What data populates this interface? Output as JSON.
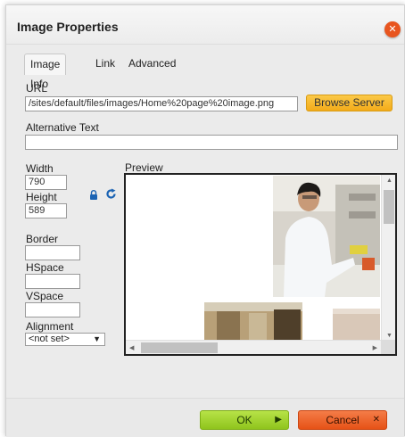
{
  "dialog": {
    "title": "Image Properties",
    "close_icon": "close-icon",
    "tabs": [
      {
        "label": "Image Info",
        "active": true
      },
      {
        "label": "Link",
        "active": false
      },
      {
        "label": "Advanced",
        "active": false
      }
    ]
  },
  "image_info": {
    "url_label": "URL",
    "url_value": "/sites/default/files/images/Home%20page%20image.png",
    "browse_label": "Browse Server",
    "alt_label": "Alternative Text",
    "alt_value": "",
    "width_label": "Width",
    "width_value": "790",
    "height_label": "Height",
    "height_value": "589",
    "lock_icon": "lock-icon",
    "reset_icon": "reset-size-icon",
    "border_label": "Border",
    "border_value": "",
    "hspace_label": "HSpace",
    "hspace_value": "",
    "vspace_label": "VSpace",
    "vspace_value": "",
    "alignment_label": "Alignment",
    "alignment_value": "<not set>",
    "preview_label": "Preview"
  },
  "footer": {
    "ok_label": "OK",
    "cancel_label": "Cancel"
  },
  "colors": {
    "browse": "#f3ab19",
    "ok": "#8fc41d",
    "cancel": "#e65217",
    "close": "#e8551f"
  }
}
